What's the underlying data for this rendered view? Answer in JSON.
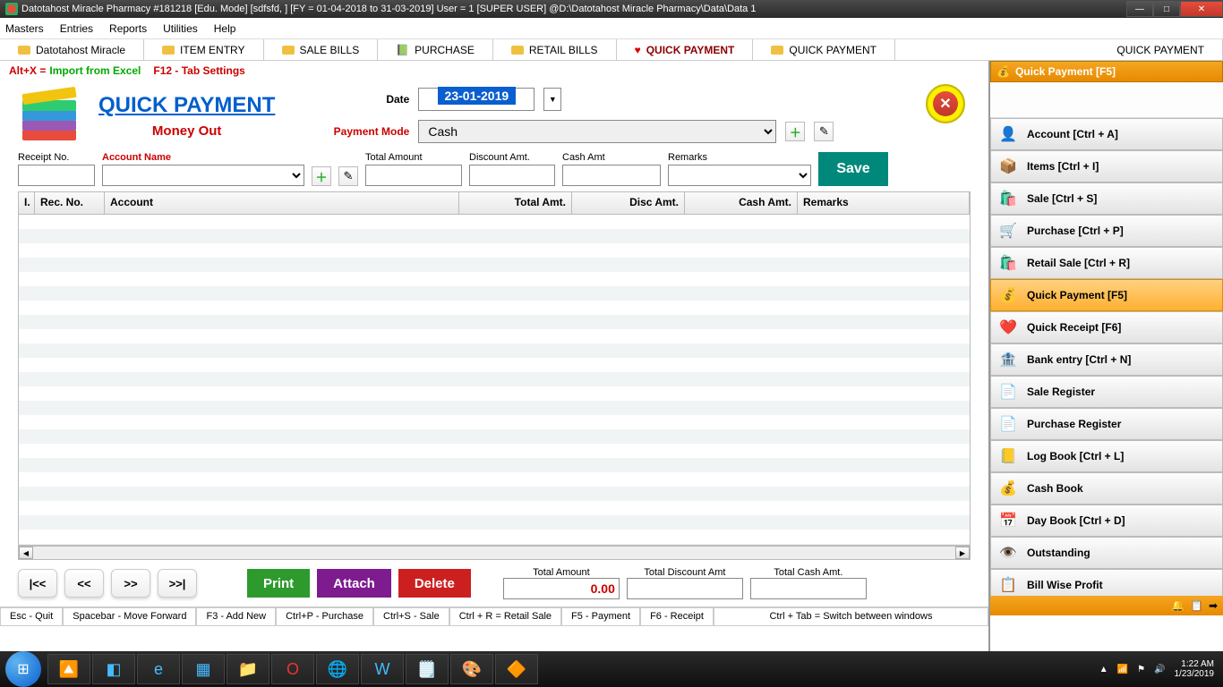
{
  "window": {
    "title": "Datotahost Miracle Pharmacy #181218  [Edu. Mode]  [sdfsfd, ] [FY = 01-04-2018 to 31-03-2019] User = 1 [SUPER USER]  @D:\\Datotahost Miracle Pharmacy\\Data\\Data 1"
  },
  "menu": [
    "Masters",
    "Entries",
    "Reports",
    "Utilities",
    "Help"
  ],
  "tabs": [
    {
      "label": "Datotahost Miracle"
    },
    {
      "label": "ITEM ENTRY"
    },
    {
      "label": "SALE BILLS"
    },
    {
      "label": "PURCHASE"
    },
    {
      "label": "RETAIL BILLS"
    },
    {
      "label": "QUICK PAYMENT",
      "active": true
    },
    {
      "label": "QUICK PAYMENT"
    },
    {
      "label": "QUICK PAYMENT"
    }
  ],
  "shortcuts": {
    "altx_prefix": "Alt+X =",
    "altx_label": "Import from Excel",
    "f12": "F12 - Tab Settings"
  },
  "header": {
    "title": "QUICK PAYMENT",
    "subtitle": "Money Out",
    "date_label": "Date",
    "date_value": "23-01-2019",
    "pm_label": "Payment Mode",
    "pm_value": "Cash"
  },
  "fields": {
    "receipt_no": "Receipt No.",
    "account_name": "Account Name",
    "total_amount": "Total Amount",
    "discount_amt": "Discount Amt.",
    "cash_amt": "Cash Amt",
    "remarks": "Remarks",
    "save": "Save"
  },
  "grid": {
    "cols": [
      "I.",
      "Rec. No.",
      "Account",
      "Total Amt.",
      "Disc Amt.",
      "Cash Amt.",
      "Remarks"
    ]
  },
  "footer": {
    "nav": [
      "|<<",
      "<<",
      ">>",
      ">>|"
    ],
    "print": "Print",
    "attach": "Attach",
    "delete": "Delete",
    "total_amount_label": "Total Amount",
    "total_amount_value": "0.00",
    "total_disc_label": "Total Discount Amt",
    "total_cash_label": "Total Cash Amt."
  },
  "statusbar": [
    "Esc - Quit",
    "Spacebar - Move Forward",
    "F3 - Add New",
    "Ctrl+P - Purchase",
    "Ctrl+S - Sale",
    "Ctrl + R = Retail Sale",
    "F5 - Payment",
    "F6 - Receipt",
    "Ctrl + Tab = Switch between windows"
  ],
  "sidepanel": {
    "title": "Quick Payment [F5]",
    "items": [
      "Account [Ctrl + A]",
      "Items [Ctrl + I]",
      "Sale [Ctrl + S]",
      "Purchase [Ctrl + P]",
      "Retail Sale [Ctrl + R]",
      "Quick Payment [F5]",
      "Quick Receipt [F6]",
      "Bank entry [Ctrl + N]",
      "Sale Register",
      "Purchase Register",
      "Log Book [Ctrl + L]",
      "Cash Book",
      "Day Book [Ctrl + D]",
      "Outstanding",
      "Bill Wise Profit"
    ],
    "icons": [
      "👤",
      "📦",
      "🛍️",
      "🛒",
      "🛍️",
      "💰",
      "❤️",
      "🏦",
      "📄",
      "📄",
      "📒",
      "💰",
      "📅",
      "👁️",
      "📋"
    ],
    "selected": 5
  },
  "taskbar": {
    "time": "1:22 AM",
    "date": "1/23/2019"
  }
}
